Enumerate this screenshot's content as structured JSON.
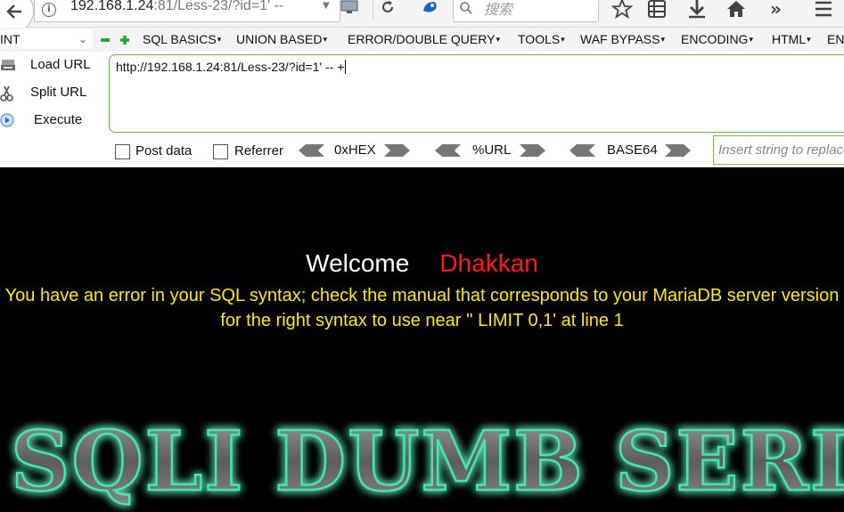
{
  "browser": {
    "url_host": "192.168.1.24",
    "url_rest": ":81/Less-23/?id=1' --",
    "search_placeholder": "搜索"
  },
  "hackbar": {
    "type_select": "INT",
    "menus": [
      "SQL BASICS",
      "UNION BASED",
      "ERROR/DOUBLE QUERY",
      "TOOLS",
      "WAF BYPASS",
      "ENCODING",
      "HTML",
      "ENC"
    ],
    "buttons": {
      "load": "Load URL",
      "split": "Split URL",
      "execute": "Execute"
    },
    "url_value": "http://192.168.1.24:81/Less-23/?id=1' -- +",
    "post_data": "Post data",
    "referrer": "Referrer",
    "encoders": [
      "0xHEX",
      "%URL",
      "BASE64"
    ],
    "replace_placeholder": "Insert string to replace"
  },
  "page": {
    "welcome": "Welcome",
    "name": "Dhakkan",
    "error": "You have an error in your SQL syntax; check the manual that corresponds to your MariaDB server version for the right syntax to use near '' LIMIT 0,1' at line 1",
    "logo_text": "SQLI DUMB SERIES"
  },
  "colors": {
    "welcome": "#ffffff",
    "name": "#ff1a1a",
    "error": "#ffea00",
    "logo_glow": "#2fe0a0"
  }
}
